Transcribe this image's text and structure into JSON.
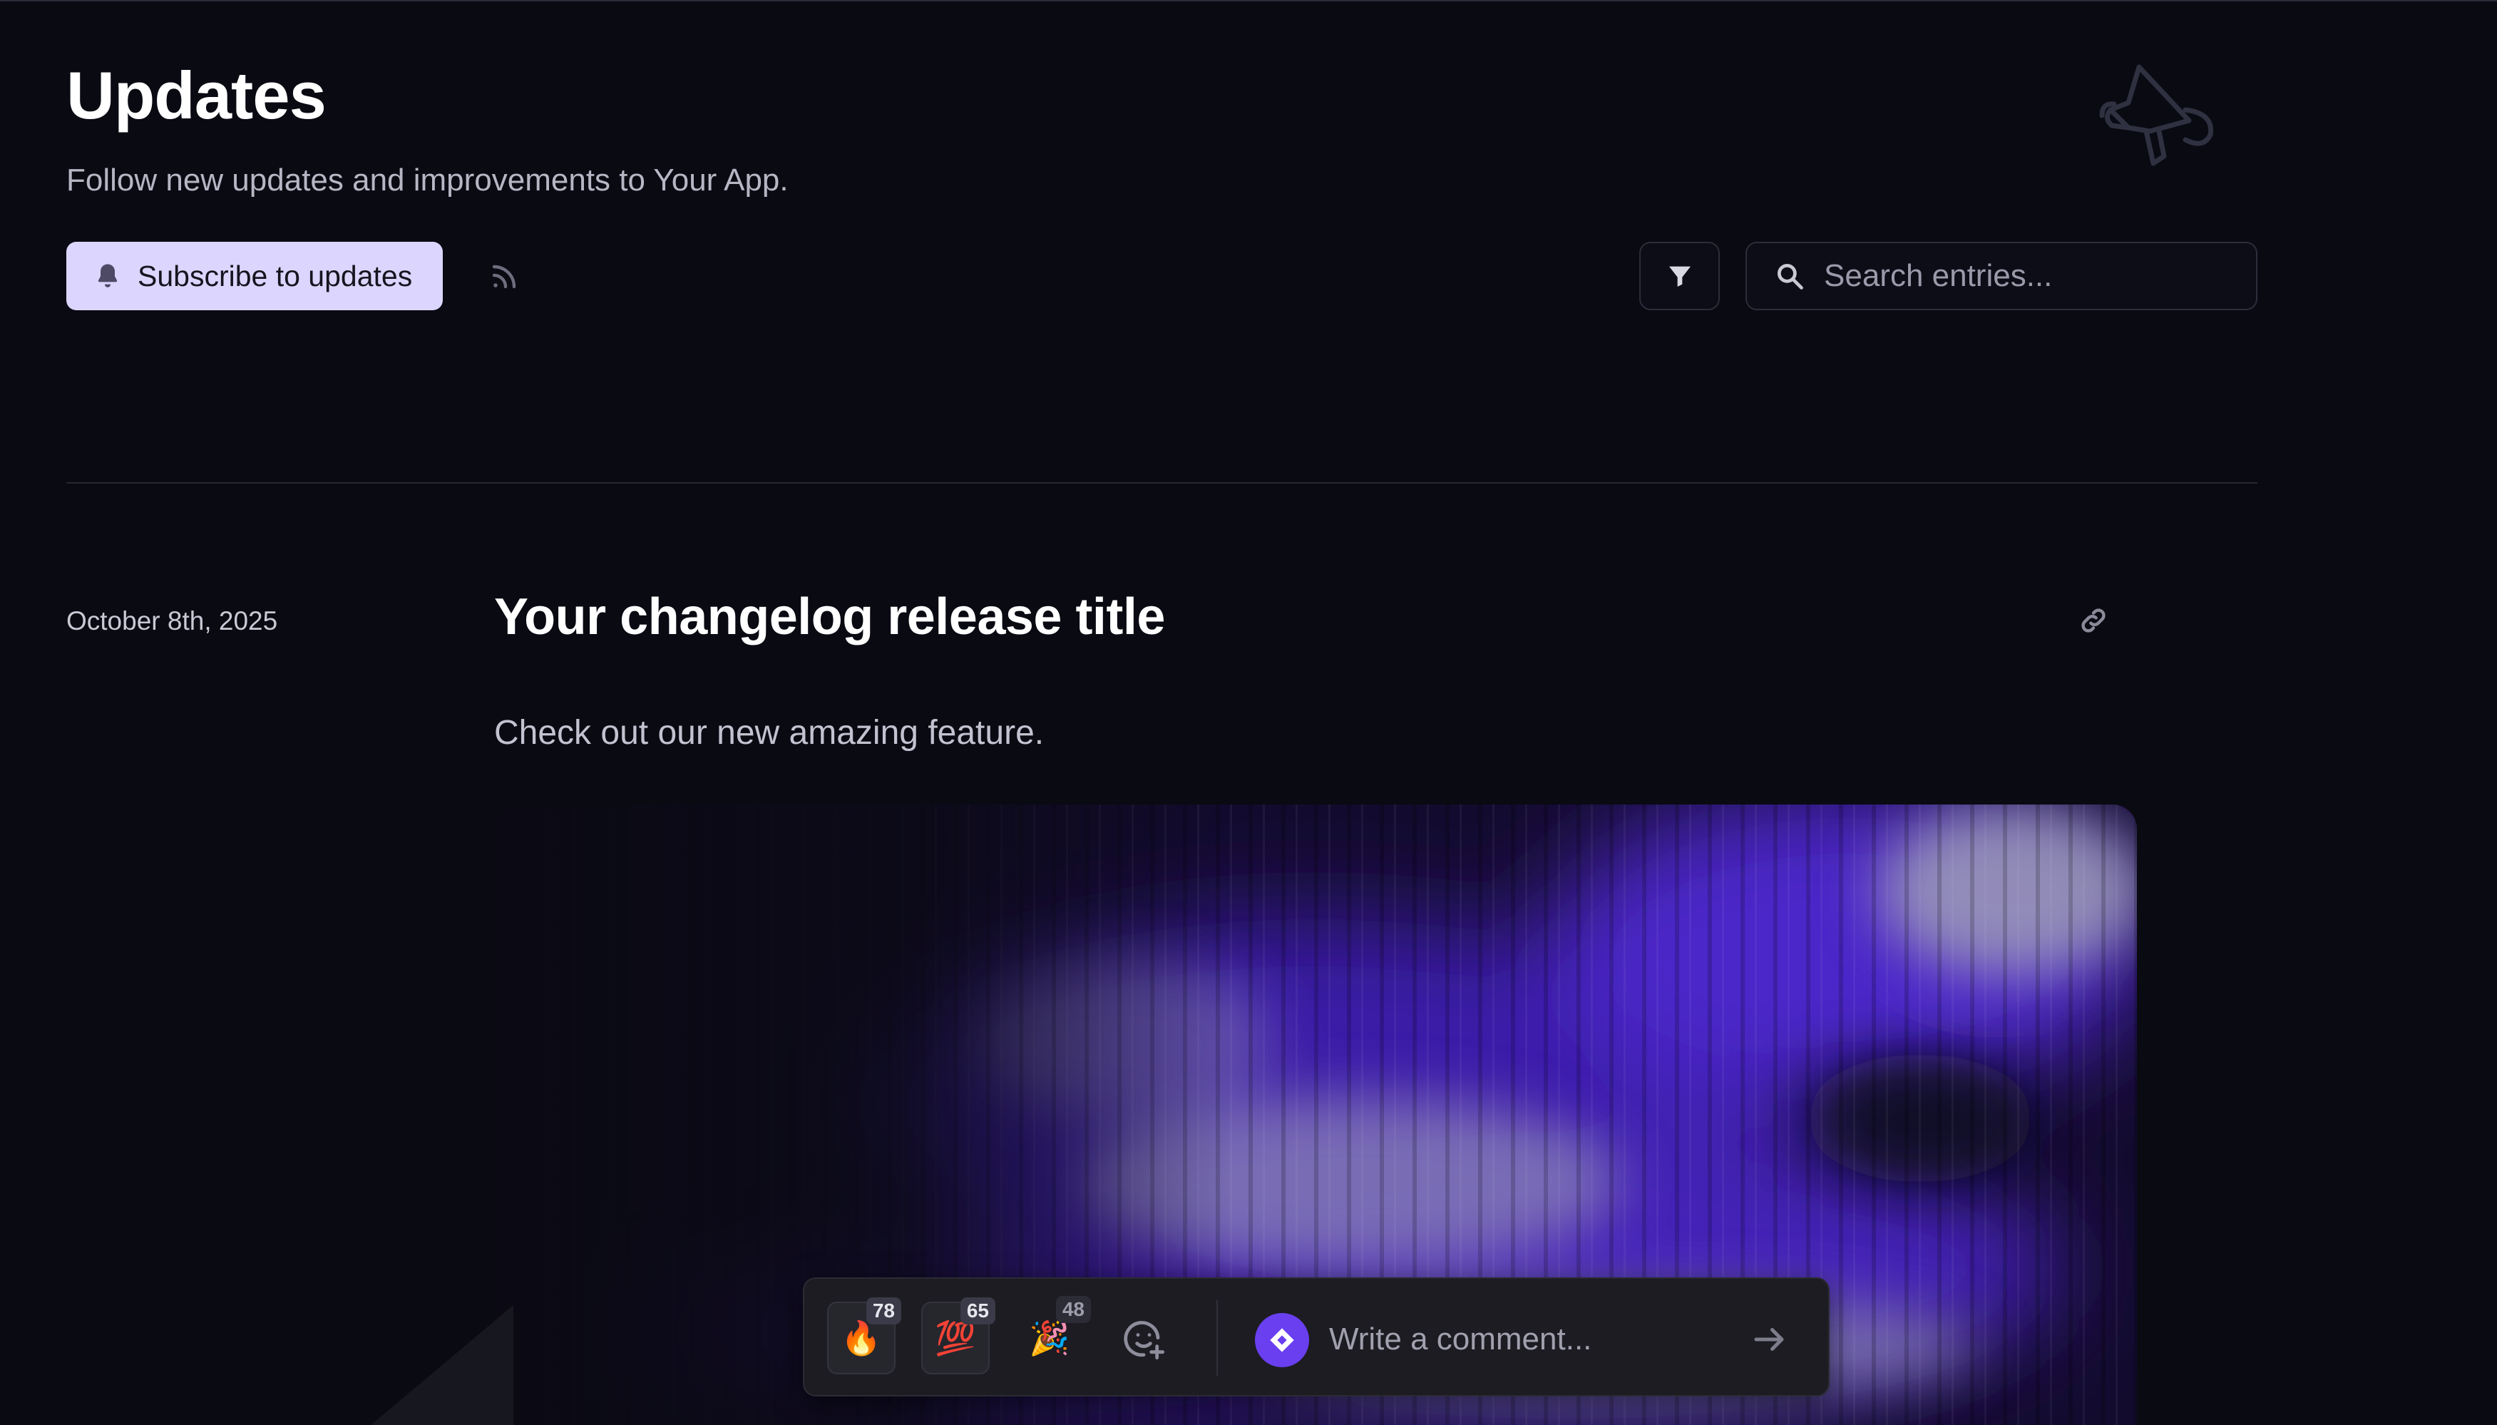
{
  "header": {
    "title": "Updates",
    "subtitle": "Follow new updates and improvements to Your App.",
    "hero_icon": "megaphone-icon"
  },
  "toolbar": {
    "subscribe_label": "Subscribe to updates",
    "subscribe_icon": "bell-icon",
    "rss_icon": "rss-icon",
    "filter_icon": "filter-icon",
    "search_icon": "search-icon",
    "search_placeholder": "Search entries...",
    "search_value": ""
  },
  "entry": {
    "date": "October 8th, 2025",
    "title": "Your changelog release title",
    "body": "Check out our new amazing feature.",
    "link_icon": "link-icon"
  },
  "reactions": [
    {
      "emoji": "🔥",
      "name": "fire",
      "count": "78"
    },
    {
      "emoji": "💯",
      "name": "hundred",
      "count": "65"
    },
    {
      "emoji": "🎉",
      "name": "party",
      "count": "48"
    }
  ],
  "comment": {
    "placeholder": "Write a comment...",
    "value": "",
    "add_reaction_icon": "add-emoji-icon",
    "send_icon": "arrow-right-icon"
  },
  "colors": {
    "background": "#090a12",
    "accent": "#6a3ff0",
    "subscribe_bg": "#dcd6ff"
  }
}
